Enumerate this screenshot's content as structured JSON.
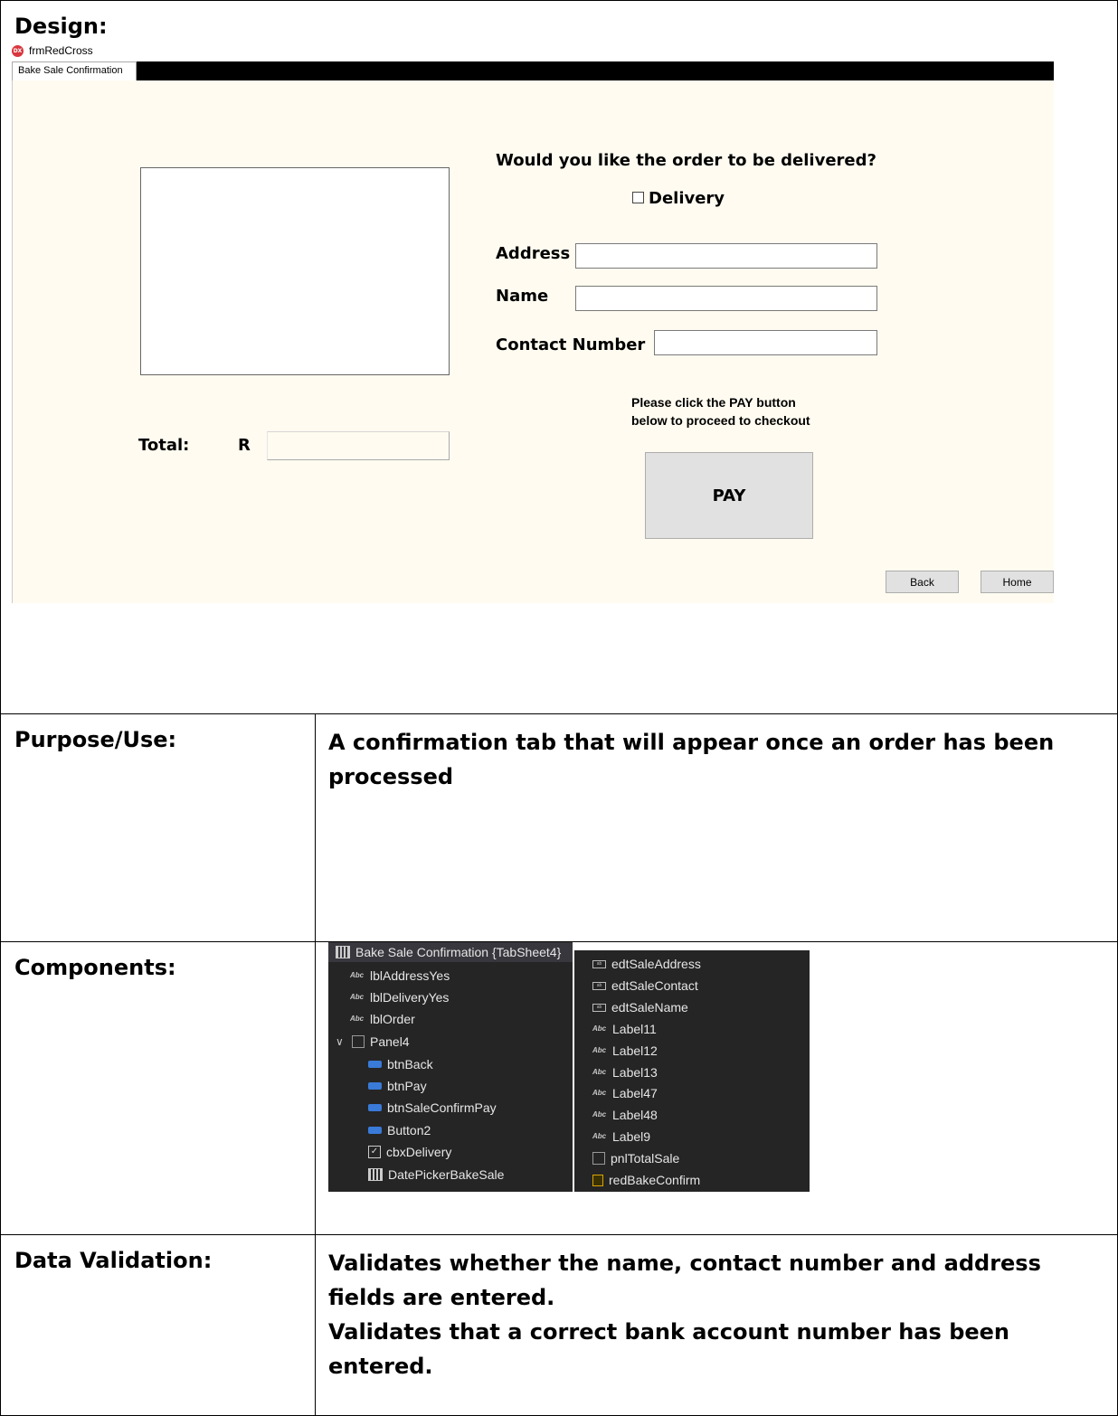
{
  "sections": {
    "design": "Design:",
    "purpose_label": "Purpose/Use:",
    "purpose_text": "A confirmation tab that will appear once an order has been processed",
    "components_label": "Components:",
    "validation_label": "Data Validation:",
    "validation_line1": "Validates whether the name, contact number and address fields are entered.",
    "validation_line2": "Validates that a correct bank account number has been entered."
  },
  "app": {
    "window_title": "frmRedCross",
    "icon_text": "DX",
    "tab": "Bake Sale Confirmation"
  },
  "form": {
    "delivery_question": "Would you like the order to be delivered?",
    "delivery_checkbox": "Delivery",
    "address_label": "Address",
    "name_label": "Name",
    "contact_label": "Contact Number",
    "total_label": "Total:",
    "currency": "R",
    "hint_line1": "Please click the PAY button",
    "hint_line2": "below to proceed to checkout",
    "pay_button": "PAY",
    "back_button": "Back",
    "home_button": "Home"
  },
  "components": {
    "left": [
      {
        "name": "Bake Sale Confirmation {TabSheet4}",
        "icon": "tabsheet-icon"
      },
      {
        "name": "lblAddressYes",
        "icon": "label-icon"
      },
      {
        "name": "lblDeliveryYes",
        "icon": "label-icon"
      },
      {
        "name": "lblOrder",
        "icon": "label-icon"
      },
      {
        "name": "Panel4",
        "icon": "panel-icon"
      },
      {
        "name": "btnBack",
        "icon": "button-icon"
      },
      {
        "name": "btnPay",
        "icon": "button-icon"
      },
      {
        "name": "btnSaleConfirmPay",
        "icon": "button-icon"
      },
      {
        "name": "Button2",
        "icon": "button-icon"
      },
      {
        "name": "cbxDelivery",
        "icon": "checkbox-icon"
      },
      {
        "name": "DatePickerBakeSale",
        "icon": "datepicker-icon"
      }
    ],
    "right": [
      {
        "name": "edtSaleAddress",
        "icon": "edit-icon"
      },
      {
        "name": "edtSaleContact",
        "icon": "edit-icon"
      },
      {
        "name": "edtSaleName",
        "icon": "edit-icon"
      },
      {
        "name": "Label11",
        "icon": "label-icon"
      },
      {
        "name": "Label12",
        "icon": "label-icon"
      },
      {
        "name": "Label13",
        "icon": "label-icon"
      },
      {
        "name": "Label47",
        "icon": "label-icon"
      },
      {
        "name": "Label48",
        "icon": "label-icon"
      },
      {
        "name": "Label9",
        "icon": "label-icon"
      },
      {
        "name": "pnlTotalSale",
        "icon": "panel-icon"
      },
      {
        "name": "redBakeConfirm",
        "icon": "richedit-icon"
      }
    ]
  }
}
